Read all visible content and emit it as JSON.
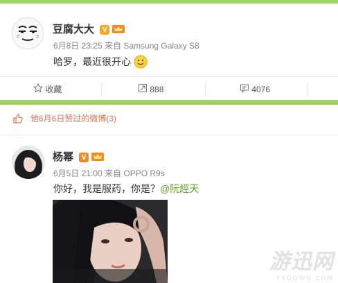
{
  "post1": {
    "username": "豆腐大大",
    "badge_v": "V",
    "meta": "6月8日 23:25 来自 Samsung Galaxy S8",
    "content": "哈罗，最近很开心",
    "emoji": "smile-emoji"
  },
  "actions": {
    "favorite_label": "收藏",
    "repost_count": "888",
    "comment_count": "4076"
  },
  "liked": {
    "text": "他6月6日赞过的微博(3)"
  },
  "post2": {
    "username": "杨幂",
    "badge_v": "V",
    "meta": "6月5日 21:00 来自 OPPO R9s",
    "content_prefix": "你好，我是服药，你是？",
    "mention": "@阮經天"
  },
  "watermark": {
    "main": "游迅网",
    "sub": "YXDOWN.COM"
  },
  "colors": {
    "accent_green": "#9dd266",
    "link_blue": "#3a8dcc",
    "mention_green": "#5ba32a",
    "liked_orange": "#eb7350",
    "v_orange": "#f5a623"
  }
}
